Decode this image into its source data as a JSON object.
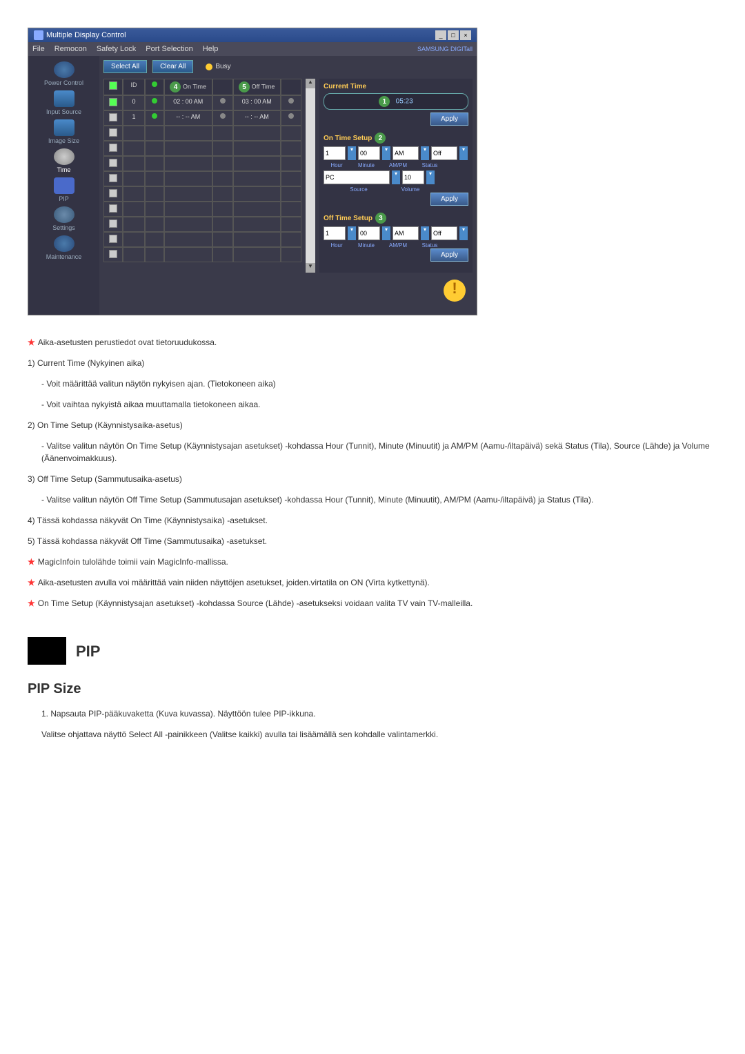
{
  "titlebar": {
    "title": "Multiple Display Control",
    "min": "_",
    "max": "□",
    "close": "×"
  },
  "menubar": {
    "items": [
      "File",
      "Remocon",
      "Safety Lock",
      "Port Selection",
      "Help"
    ],
    "logo": "SAMSUNG DIGITall"
  },
  "sidebar": {
    "items": [
      {
        "label": "Power Control"
      },
      {
        "label": "Input Source"
      },
      {
        "label": "Image Size"
      },
      {
        "label": "Time"
      },
      {
        "label": "PIP"
      },
      {
        "label": "Settings"
      },
      {
        "label": "Maintenance"
      }
    ]
  },
  "toolbar": {
    "select_all": "Select All",
    "clear_all": "Clear All",
    "busy": "Busy"
  },
  "grid": {
    "headers": {
      "on_time": "On Time",
      "off_time": "Off Time",
      "callout4": "4",
      "callout5": "5"
    },
    "rows": [
      {
        "checked": true,
        "id": "0",
        "power": "green",
        "on_time": "02 : 00  AM",
        "on_st": "gray",
        "off_time": "03 : 00  AM",
        "off_st": "gray"
      },
      {
        "checked": false,
        "id": "1",
        "power": "green",
        "on_time": "-- : --  AM",
        "on_st": "gray",
        "off_time": "-- : --  AM",
        "off_st": "gray"
      },
      {
        "checked": false,
        "id": "",
        "power": "",
        "on_time": "",
        "on_st": "",
        "off_time": "",
        "off_st": ""
      },
      {
        "checked": false,
        "id": "",
        "power": "",
        "on_time": "",
        "on_st": "",
        "off_time": "",
        "off_st": ""
      },
      {
        "checked": false,
        "id": "",
        "power": "",
        "on_time": "",
        "on_st": "",
        "off_time": "",
        "off_st": ""
      },
      {
        "checked": false,
        "id": "",
        "power": "",
        "on_time": "",
        "on_st": "",
        "off_time": "",
        "off_st": ""
      },
      {
        "checked": false,
        "id": "",
        "power": "",
        "on_time": "",
        "on_st": "",
        "off_time": "",
        "off_st": ""
      },
      {
        "checked": false,
        "id": "",
        "power": "",
        "on_time": "",
        "on_st": "",
        "off_time": "",
        "off_st": ""
      },
      {
        "checked": false,
        "id": "",
        "power": "",
        "on_time": "",
        "on_st": "",
        "off_time": "",
        "off_st": ""
      },
      {
        "checked": false,
        "id": "",
        "power": "",
        "on_time": "",
        "on_st": "",
        "off_time": "",
        "off_st": ""
      },
      {
        "checked": false,
        "id": "",
        "power": "",
        "on_time": "",
        "on_st": "",
        "off_time": "",
        "off_st": ""
      }
    ]
  },
  "panel": {
    "current_time_title": "Current Time",
    "callout1": "1",
    "time_value": "05:23",
    "apply": "Apply",
    "on_time_title": "On Time Setup",
    "callout2": "2",
    "on": {
      "hour": "1",
      "minute": "00",
      "ampm": "AM",
      "status": "Off",
      "source": "PC",
      "volume": "10"
    },
    "labels": {
      "hour": "Hour",
      "minute": "Minute",
      "ampm": "AM/PM",
      "status": "Status",
      "source": "Source",
      "volume": "Volume"
    },
    "off_time_title": "Off Time Setup",
    "callout3": "3",
    "off": {
      "hour": "1",
      "minute": "00",
      "ampm": "AM",
      "status": "Off"
    }
  },
  "doc": {
    "star_intro": "Aika-asetusten perustiedot ovat tietoruudukossa.",
    "item1": "1) Current Time (Nykyinen aika)",
    "item1a": "- Voit määrittää valitun näytön nykyisen ajan. (Tietokoneen aika)",
    "item1b": "- Voit vaihtaa nykyistä aikaa muuttamalla tietokoneen aikaa.",
    "item2": "2) On Time Setup (Käynnistysaika-asetus)",
    "item2a": "- Valitse valitun näytön On Time Setup (Käynnistysajan asetukset) -kohdassa Hour (Tunnit), Minute (Minuutit) ja AM/PM (Aamu-/iltapäivä) sekä Status (Tila), Source (Lähde) ja Volume (Äänenvoimakkuus).",
    "item3": "3) Off Time Setup (Sammutusaika-asetus)",
    "item3a": "- Valitse valitun näytön Off Time Setup (Sammutusajan asetukset) -kohdassa Hour (Tunnit), Minute (Minuutit), AM/PM (Aamu-/iltapäivä) ja Status (Tila).",
    "item4": "4) Tässä kohdassa näkyvät On Time (Käynnistysaika) -asetukset.",
    "item5": "5) Tässä kohdassa näkyvät Off Time (Sammutusaika) -asetukset.",
    "star2": "MagicInfoin tulolähde toimii vain MagicInfo-mallissa.",
    "star3": "Aika-asetusten avulla voi määrittää vain niiden näyttöjen asetukset, joiden.virtatila on ON (Virta kytkettynä).",
    "star4": "On Time Setup (Käynnistysajan asetukset) -kohdassa Source (Lähde) -asetukseksi voidaan valita TV vain TV-malleilla.",
    "sec_title": "PIP",
    "sub_title": "PIP Size",
    "step1": "1. Napsauta PIP-pääkuvaketta (Kuva kuvassa). Näyttöön tulee PIP-ikkuna.",
    "step1a": "Valitse ohjattava näyttö Select All -painikkeen (Valitse kaikki) avulla tai lisäämällä sen kohdalle valintamerkki."
  }
}
